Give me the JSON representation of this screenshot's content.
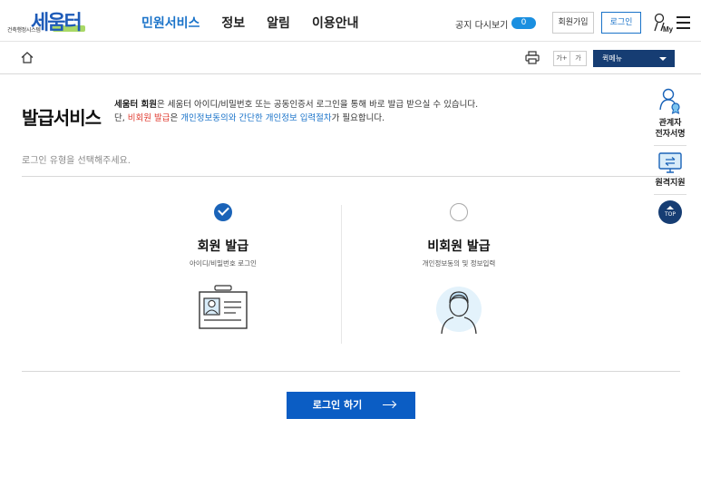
{
  "header": {
    "logo_sub": "건축행정시스템",
    "logo_main": "세움터",
    "nav": [
      "민원서비스",
      "정보",
      "알림",
      "이용안내"
    ],
    "notice_label": "공지 다시보기",
    "notice_count": "0",
    "join_label": "회원가입",
    "login_label": "로그인",
    "my_label": "My"
  },
  "subbar": {
    "font_plus": "가+",
    "font_minus": "가",
    "quick_menu": "퀵메뉴"
  },
  "main": {
    "title": "발급서비스",
    "desc1_bold": "세움터 회원",
    "desc1_rest": "은 세움터 아이디/비밀번호 또는 공동인증서 로그인을 통해 바로 발급 받으실 수 있습니다.",
    "desc2_prefix": "단, ",
    "desc2_red": "비회원 발급",
    "desc2_mid": "은 ",
    "desc2_blue": "개인정보동의와 간단한 개인정보 입력절차",
    "desc2_suffix": "가 필요합니다.",
    "select_prompt": "로그인 유형을 선택해주세요.",
    "options": [
      {
        "title": "회원 발급",
        "sub": "아이디/비밀번호 로그인",
        "selected": true,
        "icon": "id-card-icon"
      },
      {
        "title": "비회원 발급",
        "sub": "개인정보동의 및 정보입력",
        "selected": false,
        "icon": "person-icon"
      }
    ],
    "login_button": "로그인 하기"
  },
  "side": {
    "items": [
      "관계자\n전자서명",
      "원격지원"
    ],
    "signer_label_1": "관계자",
    "signer_label_2": "전자서명",
    "remote_label": "원격지원",
    "top_label": "TOP"
  },
  "colors": {
    "primary": "#0b5dc4",
    "nav_active": "#1a73c9",
    "dark_navy": "#163d73",
    "red": "#e03c31",
    "logo_green": "#9ad14b"
  }
}
